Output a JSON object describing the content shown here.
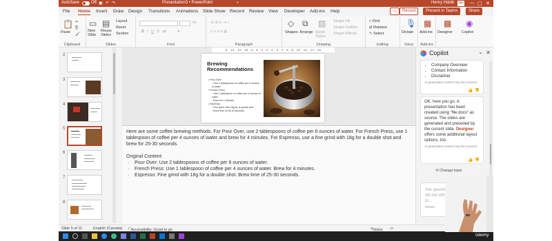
{
  "titlebar": {
    "autosave_label": "AutoSave",
    "autosave_state": "Off",
    "document_title": "Presentation3 • PowerPoint",
    "user_name": "Henry Habib",
    "user_initials": "HH"
  },
  "menu": {
    "tabs": [
      "File",
      "Home",
      "Insert",
      "Draw",
      "Design",
      "Transitions",
      "Animations",
      "Slide Show",
      "Record",
      "Review",
      "View",
      "Developer",
      "Add-ins",
      "Help"
    ],
    "active_tab": "Home",
    "record_label": "Record",
    "present_label": "Present in Teams",
    "share_label": "Share"
  },
  "ribbon": {
    "paste": "Paste",
    "new_slide": "New Slide",
    "reuse_slides": "Reuse Slides",
    "layout": "Layout",
    "reset": "Reset",
    "section": "Section",
    "shapes": "Shapes",
    "arrange": "Arrange",
    "quick_styles": "Quick Styles",
    "shape_fill": "Shape Fill",
    "shape_outline": "Shape Outline",
    "shape_effects": "Shape Effects",
    "find": "Find",
    "replace": "Replace",
    "select": "Select",
    "dictate": "Dictate",
    "add_ins": "Add-ins",
    "designer_copilot": "Designer Copilot",
    "groups": {
      "clipboard": "Clipboard",
      "slides": "Slides",
      "font": "Font",
      "paragraph": "Paragraph",
      "drawing": "Drawing",
      "editing": "Editing",
      "voice": "Voice",
      "add_ins": "Add-ins"
    }
  },
  "thumbnails": {
    "numbers": [
      "2",
      "3",
      "4",
      "5",
      "6",
      "7",
      "8"
    ],
    "selected": "5"
  },
  "slide": {
    "ruler": "6 · 14 · 12 · 10 · 8 · 6 · 4 · 2 · 0 · 2 · 4 · 6 · 8 · 10 · 12 · 14 · 16",
    "title": "Brewing Recommendations",
    "bullets": [
      {
        "text": "Pour Over",
        "level": 0
      },
      {
        "text": "Use 2 tablespoons of coffee per 6 ounces of water",
        "level": 1
      },
      {
        "text": "French Press",
        "level": 0
      },
      {
        "text": "Use 1 tablespoon of coffee per 4 ounces of water",
        "level": 1
      },
      {
        "text": "Brew for 4 minutes",
        "level": 1
      },
      {
        "text": "Espresso",
        "level": 0
      },
      {
        "text": "Fine grind with 18g for a double shot",
        "level": 1
      },
      {
        "text": "Brew time of 25-30 seconds",
        "level": 1
      }
    ]
  },
  "notes": {
    "summary": "Here are some coffee brewing methods. For Pour Over, use 2 tablespoons of coffee per 6 ounces of water. For French Press, use 1 tablespoon of coffee per 4 ounces of water and brew for 4 minutes. For Espresso, use a fine grind with 18g for a double shot and brew for 25-30 seconds.",
    "original_heading": "Original Content:",
    "original_items": [
      "Pour Over: Use 2 tablespoons of coffee per 6 ounces of water.",
      "French Press: Use 1 tablespoon of coffee per 4 ounces of water. Brew for 4 minutes.",
      "Espresso: Fine grind with 18g for a double shot. Brew time of 25-30 seconds."
    ]
  },
  "copilot": {
    "title": "Copilot",
    "card1_items": [
      "Company Overview",
      "Contact Information",
      "Disclaimer"
    ],
    "disclaimer": "AI-generated content may be incorrect",
    "card2_text_before": "OK, here you go. A presentation has been created using \"file.docx\" as source. The slides are generated and preceded by the current slide.",
    "card2_brand": "Designer",
    "card2_text_after": "offers some additional layout options, too.",
    "change_topic": "Change topic",
    "input_placeholder": "Ask questions or tell me with this pr...",
    "input_count": "0/2000"
  },
  "status": {
    "slide_count": "Slide 5 of 11",
    "language": "English (Canada)",
    "accessibility": "Accessibility: Good to go",
    "notes": "Notes"
  },
  "taskbar": {
    "watermark": "ûdemy"
  },
  "colors": {
    "accent": "#b7472a",
    "copilot_brand": "#c43e1c"
  }
}
